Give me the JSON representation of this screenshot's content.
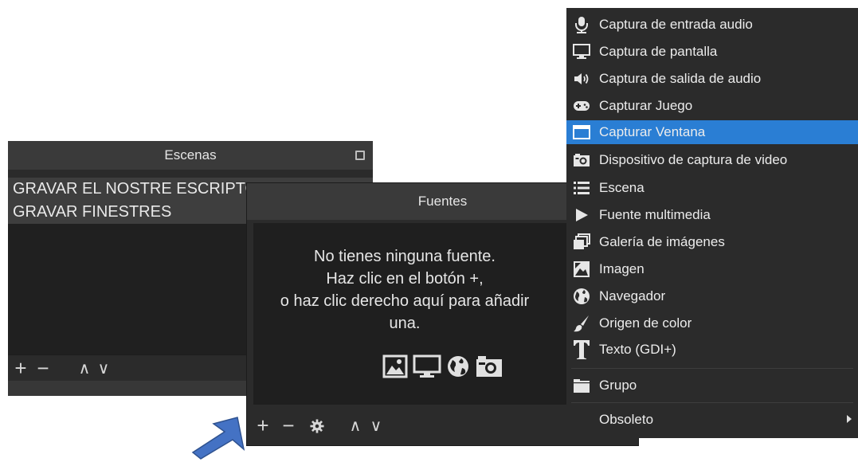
{
  "scenes_panel": {
    "title": "Escenas",
    "items": [
      "GRAVAR EL NOSTRE ESCRIPTORI",
      "GRAVAR FINESTRES"
    ],
    "toolbar": {
      "add": "+",
      "remove": "−",
      "up": "∧",
      "down": "∨"
    }
  },
  "sources_panel": {
    "title": "Fuentes",
    "empty_message": [
      "No tienes ninguna fuente.",
      "Haz clic en el botón +,",
      "o haz clic derecho aquí para añadir",
      "una."
    ],
    "toolbar": {
      "add": "+",
      "remove": "−",
      "up": "∧",
      "down": "∨"
    }
  },
  "context_menu": {
    "items": [
      {
        "label": "Captura de entrada audio",
        "icon": "microphone-icon"
      },
      {
        "label": "Captura de pantalla",
        "icon": "monitor-icon"
      },
      {
        "label": "Captura de salida de audio",
        "icon": "speaker-icon"
      },
      {
        "label": "Capturar Juego",
        "icon": "gamepad-icon"
      },
      {
        "label": "Capturar Ventana",
        "icon": "window-icon",
        "selected": true
      },
      {
        "label": "Dispositivo de captura de video",
        "icon": "camera-icon"
      },
      {
        "label": "Escena",
        "icon": "list-icon"
      },
      {
        "label": "Fuente multimedia",
        "icon": "play-icon"
      },
      {
        "label": "Galería de imágenes",
        "icon": "gallery-icon"
      },
      {
        "label": "Imagen",
        "icon": "image-icon"
      },
      {
        "label": "Navegador",
        "icon": "globe-icon"
      },
      {
        "label": "Origen de color",
        "icon": "brush-icon"
      },
      {
        "label": "Texto (GDI+)",
        "icon": "text-icon"
      }
    ],
    "group": {
      "label": "Grupo",
      "icon": "folder-icon"
    },
    "obsolete": {
      "label": "Obsoleto"
    }
  },
  "colors": {
    "highlight": "#2a7ed4",
    "panel": "#2b2b2b",
    "arrow": "#4472c4"
  }
}
